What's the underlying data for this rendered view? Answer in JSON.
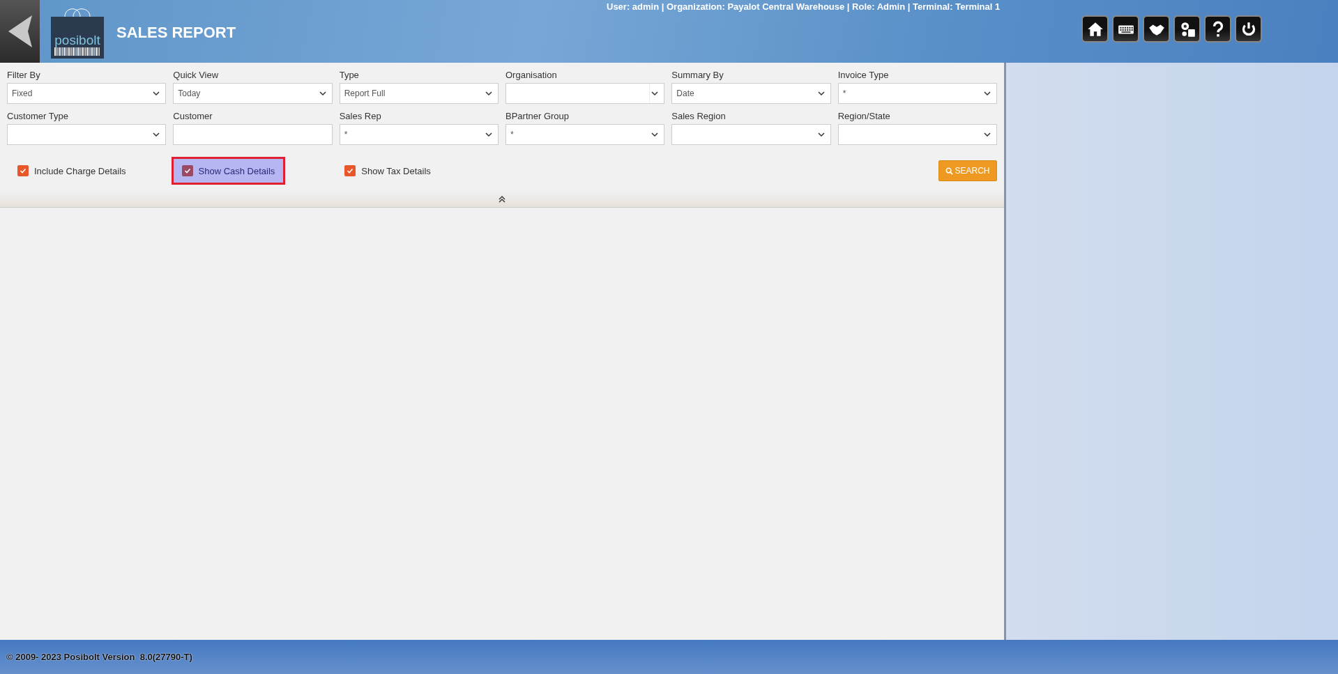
{
  "header": {
    "logo_text": "posibolt",
    "title": "SALES REPORT",
    "user_info": "User: admin | Organization: Payalot Central Warehouse | Role: Admin | Terminal: Terminal 1"
  },
  "filters": [
    {
      "label": "Filter By",
      "kind": "select",
      "value": "Fixed"
    },
    {
      "label": "Quick View",
      "kind": "select",
      "value": "Today"
    },
    {
      "label": "Type",
      "kind": "select",
      "value": "Report Full"
    },
    {
      "label": "Organisation",
      "kind": "select-split"
    },
    {
      "label": "Summary By",
      "kind": "select",
      "value": "Date"
    },
    {
      "label": "Invoice Type",
      "kind": "select",
      "value": "*"
    },
    {
      "label": "Customer Type",
      "kind": "select"
    },
    {
      "label": "Customer",
      "kind": "text"
    },
    {
      "label": "Sales Rep",
      "kind": "select",
      "value": "*"
    },
    {
      "label": "BPartner Group",
      "kind": "select",
      "value": "*"
    },
    {
      "label": "Sales Region",
      "kind": "select"
    },
    {
      "label": "Region/State",
      "kind": "select"
    }
  ],
  "options": [
    {
      "label": "Include Charge Details",
      "checked": true,
      "highlighted": false
    },
    {
      "label": "Show Cash Details",
      "checked": true,
      "highlighted": true
    },
    {
      "label": "Show Tax Details",
      "checked": true,
      "highlighted": false
    }
  ],
  "search_button": "SEARCH",
  "footer": "© 2009- 2023 Posibolt Version  8.0(27790-T)"
}
